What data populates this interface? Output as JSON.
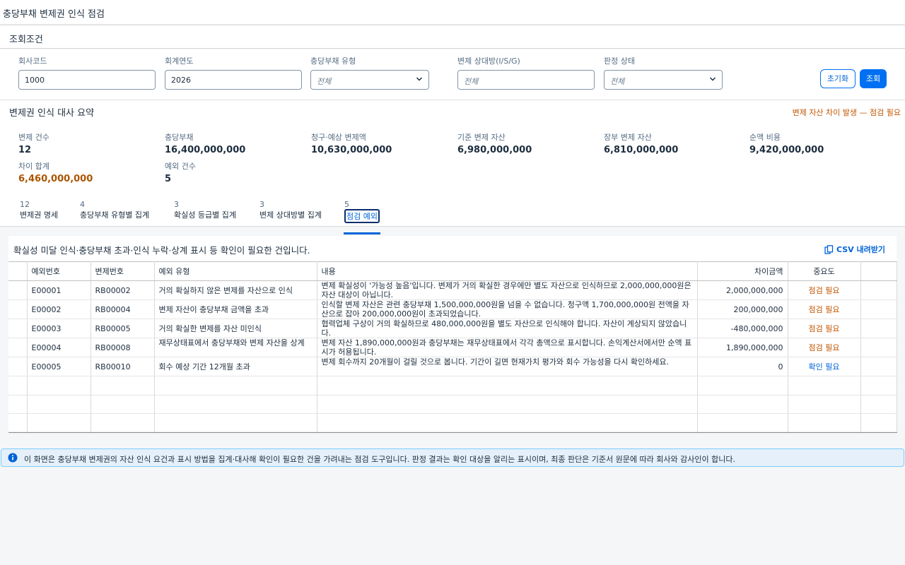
{
  "page": {
    "title": "충당부채 변제권 인식 점검"
  },
  "filters": {
    "header": "조회조건",
    "company_code": {
      "label": "회사코드",
      "value": "1000"
    },
    "fiscal_year": {
      "label": "회계연도",
      "value": "2026"
    },
    "provision_type": {
      "label": "충당부채 유형",
      "value": "전체"
    },
    "counterparty": {
      "label": "변제 상대방(I/S/G)",
      "placeholder": "전체"
    },
    "judgment_status": {
      "label": "판정 상태",
      "value": "전체"
    },
    "reset_label": "초기화",
    "search_label": "조회"
  },
  "summary": {
    "title": "변제권 인식 대사 요약",
    "alert": "변제 자산 차이 발생 — 점검 필요",
    "kpis": [
      {
        "label": "변제 건수",
        "value": "12"
      },
      {
        "label": "충당부채",
        "value": "16,400,000,000"
      },
      {
        "label": "청구·예상 변제액",
        "value": "10,630,000,000"
      },
      {
        "label": "기준 변제 자산",
        "value": "6,980,000,000"
      },
      {
        "label": "장부 변제 자산",
        "value": "6,810,000,000"
      },
      {
        "label": "순액 비용",
        "value": "9,420,000,000"
      },
      {
        "label": "차이 합계",
        "value": "6,460,000,000"
      },
      {
        "label": "예외 건수",
        "value": "5"
      }
    ]
  },
  "tabs": [
    {
      "count": "12",
      "label": "변제권 명세"
    },
    {
      "count": "4",
      "label": "충당부채 유형별 집계"
    },
    {
      "count": "3",
      "label": "확실성 등급별 집계"
    },
    {
      "count": "3",
      "label": "변제 상대방별 집계"
    },
    {
      "count": "5",
      "label": "점검 예외"
    }
  ],
  "exceptions": {
    "description": "확실성 미달 인식·충당부채 초과·인식 누락·상계 표시 등 확인이 필요한 건입니다.",
    "csv_label": "CSV 내려받기",
    "columns": [
      "예외번호",
      "변제번호",
      "예외 유형",
      "내용",
      "차이금액",
      "중요도"
    ],
    "rows": [
      {
        "id": "E00001",
        "ref": "RB00002",
        "type": "거의 확실하지 않은 변제를 자산으로 인식",
        "content": "변제 확실성이 '가능성 높음'입니다. 변제가 거의 확실한 경우에만 별도 자산으로 인식하므로 2,000,000,000원은 자산 대상이 아닙니다.",
        "diff": "2,000,000,000",
        "importance": "점검 필요"
      },
      {
        "id": "E00002",
        "ref": "RB00004",
        "type": "변제 자산이 충당부채 금액을 초과",
        "content": "인식할 변제 자산은 관련 충당부채 1,500,000,000원을 넘을 수 없습니다. 청구액 1,700,000,000원 전액을 자산으로 잡아 200,000,000원이 초과되었습니다.",
        "diff": "200,000,000",
        "importance": "점검 필요"
      },
      {
        "id": "E00003",
        "ref": "RB00005",
        "type": "거의 확실한 변제를 자산 미인식",
        "content": "협력업체 구상이 거의 확실하므로 480,000,000원을 별도 자산으로 인식해야 합니다. 자산이 계상되지 않았습니다.",
        "diff": "-480,000,000",
        "importance": "점검 필요"
      },
      {
        "id": "E00004",
        "ref": "RB00008",
        "type": "재무상태표에서 충당부채와 변제 자산을 상계",
        "content": "변제 자산 1,890,000,000원과 충당부채는 재무상태표에서 각각 총액으로 표시합니다. 손익계산서에서만 순액 표시가 허용됩니다.",
        "diff": "1,890,000,000",
        "importance": "점검 필요"
      },
      {
        "id": "E00005",
        "ref": "RB00010",
        "type": "회수 예상 기간 12개월 초과",
        "content": "변제 회수까지 20개월이 걸릴 것으로 봅니다. 기간이 길면 현재가치 평가와 회수 가능성을 다시 확인하세요.",
        "diff": "0",
        "importance": "확인 필요"
      }
    ]
  },
  "info": {
    "text": "이 화면은 충당부채 변제권의 자산 인식 요건과 표시 방법을 집계·대사해 확인이 필요한 건을 가려내는 점검 도구입니다. 판정 결과는 확인 대상을 알리는 표시이며, 최종 판단은 기준서 원문에 따라 회사와 감사인이 합니다."
  },
  "colors": {
    "accent": "#0070f2",
    "warning": "#c35500",
    "info_bg": "#e5f0fa"
  }
}
